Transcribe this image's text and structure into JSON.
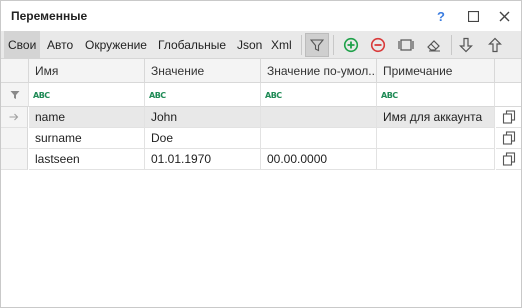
{
  "window": {
    "title": "Переменные"
  },
  "titlebar": {
    "help_glyph": "?",
    "maximize_glyph": "☐",
    "close_glyph": "✕"
  },
  "tabs": [
    {
      "label": "Свои",
      "active": true
    },
    {
      "label": "Авто"
    },
    {
      "label": "Окружение"
    },
    {
      "label": "Глобальные"
    },
    {
      "label": "Json"
    },
    {
      "label": "Xml"
    }
  ],
  "toolbar_icons": [
    "filter-icon",
    "add-icon",
    "remove-icon",
    "edit-window-icon",
    "eraser-icon",
    "arrow-down-icon",
    "arrow-up-icon"
  ],
  "columns": [
    "Имя",
    "Значение",
    "Значение по-умол...",
    "Примечание"
  ],
  "filter_placeholder": "ABC",
  "rows": [
    {
      "name": "name",
      "value": "John",
      "default": "",
      "note": "Имя для аккаунта",
      "selected": true
    },
    {
      "name": "surname",
      "value": "Doe",
      "default": "",
      "note": ""
    },
    {
      "name": "lastseen",
      "value": "01.01.1970",
      "default": "00.00.0000",
      "note": ""
    }
  ],
  "colors": {
    "accent_add": "#1fa14a",
    "accent_remove": "#d93a3a",
    "filter_abc": "#1e8a55"
  }
}
